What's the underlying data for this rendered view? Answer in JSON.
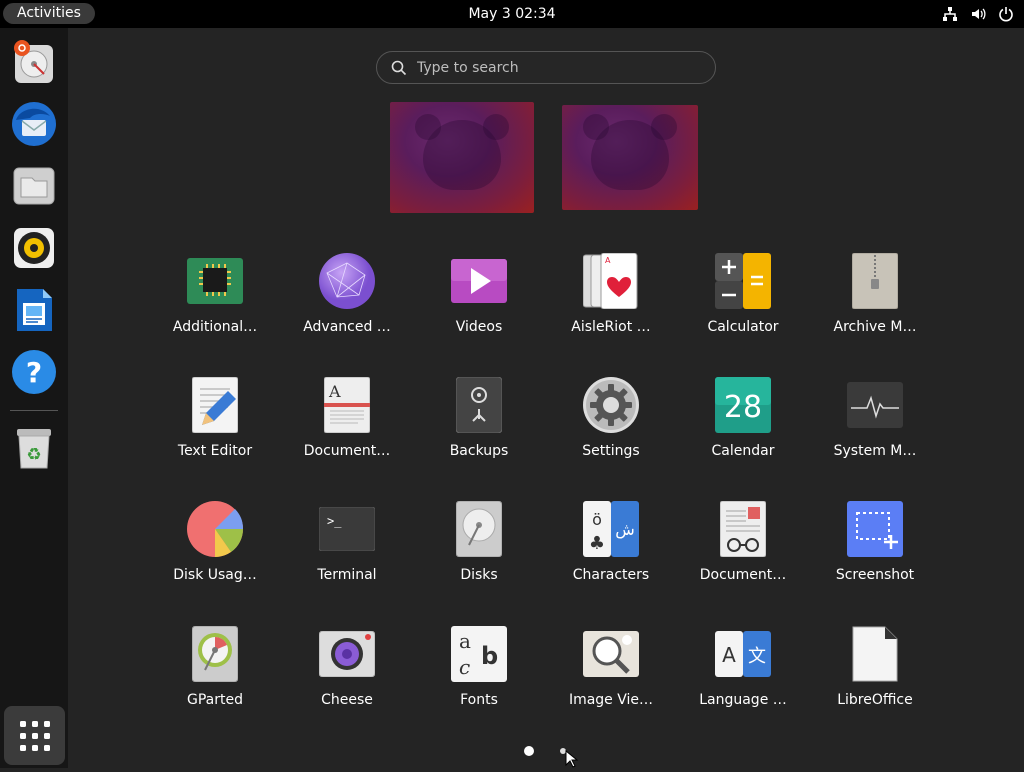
{
  "topbar": {
    "activities": "Activities",
    "datetime": "May 3  02:34"
  },
  "search": {
    "placeholder": "Type to search"
  },
  "apps": [
    {
      "label": "Additional…"
    },
    {
      "label": "Advanced …"
    },
    {
      "label": "Videos"
    },
    {
      "label": "AisleRiot …"
    },
    {
      "label": "Calculator"
    },
    {
      "label": "Archive M…"
    },
    {
      "label": "Text Editor"
    },
    {
      "label": "Document…"
    },
    {
      "label": "Backups"
    },
    {
      "label": "Settings"
    },
    {
      "label": "Calendar"
    },
    {
      "label": "System M…"
    },
    {
      "label": "Disk Usag…"
    },
    {
      "label": "Terminal"
    },
    {
      "label": "Disks"
    },
    {
      "label": "Characters"
    },
    {
      "label": "Document…"
    },
    {
      "label": "Screenshot"
    },
    {
      "label": "GParted"
    },
    {
      "label": "Cheese"
    },
    {
      "label": "Fonts"
    },
    {
      "label": "Image Vie…"
    },
    {
      "label": "Language …"
    },
    {
      "label": "LibreOffice"
    }
  ],
  "calendar_day": "28",
  "colors": {
    "panel": "#000000",
    "dock": "#161616",
    "background": "#242424"
  }
}
